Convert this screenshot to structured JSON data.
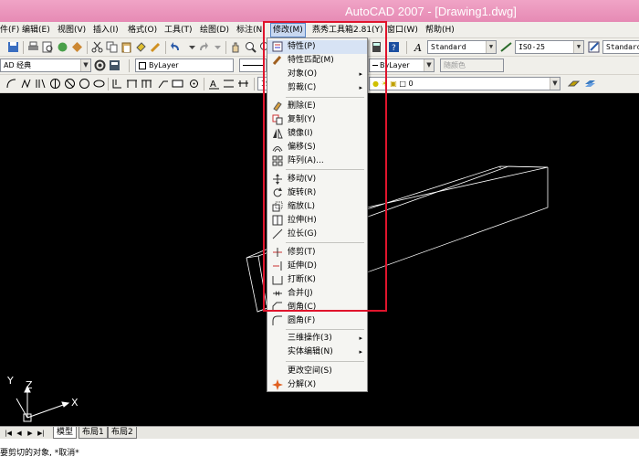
{
  "window": {
    "title": "AutoCAD 2007 - [Drawing1.dwg]"
  },
  "menubar": [
    {
      "label": "件(F)"
    },
    {
      "label": "编辑(E)"
    },
    {
      "label": "视图(V)"
    },
    {
      "label": "插入(I)"
    },
    {
      "label": "格式(O)"
    },
    {
      "label": "工具(T)"
    },
    {
      "label": "绘图(D)"
    },
    {
      "label": "标注(N)"
    },
    {
      "label": "修改(M)"
    },
    {
      "label": "燕秀工具箱2.81(Y)"
    },
    {
      "label": "窗口(W)"
    },
    {
      "label": "帮助(H)"
    }
  ],
  "toolbar1": {
    "text_style": "Standard",
    "dim_style": "ISO-25",
    "table_style": "Standard"
  },
  "toolbar2": {
    "workspace": "AD 经典",
    "color": "ByLayer",
    "linetype": "ByLayer",
    "plotstyle": "随颜色"
  },
  "toolbar3": {
    "layer_partial": "IS",
    "layer": "0"
  },
  "modify_menu": {
    "items": [
      {
        "label": "特性(P)",
        "icon": "properties-icon"
      },
      {
        "label": "特性匹配(M)",
        "icon": "match-properties-icon"
      },
      {
        "label": "对象(O)",
        "submenu": "▸"
      },
      {
        "label": "剪裁(C)",
        "submenu": "▸"
      },
      {
        "label": "删除(E)",
        "icon": "erase-icon"
      },
      {
        "label": "复制(Y)",
        "icon": "copy-icon"
      },
      {
        "label": "镜像(I)",
        "icon": "mirror-icon"
      },
      {
        "label": "偏移(S)",
        "icon": "offset-icon"
      },
      {
        "label": "阵列(A)...",
        "icon": "array-icon"
      },
      {
        "label": "移动(V)",
        "icon": "move-icon"
      },
      {
        "label": "旋转(R)",
        "icon": "rotate-icon"
      },
      {
        "label": "缩放(L)",
        "icon": "scale-icon"
      },
      {
        "label": "拉伸(H)",
        "icon": "stretch-icon"
      },
      {
        "label": "拉长(G)",
        "icon": "lengthen-icon"
      },
      {
        "label": "修剪(T)",
        "icon": "trim-icon"
      },
      {
        "label": "延伸(D)",
        "icon": "extend-icon"
      },
      {
        "label": "打断(K)",
        "icon": "break-icon"
      },
      {
        "label": "合并(J)",
        "icon": "join-icon"
      },
      {
        "label": "倒角(C)",
        "icon": "chamfer-icon"
      },
      {
        "label": "圆角(F)",
        "icon": "fillet-icon"
      },
      {
        "label": "三维操作(3)",
        "submenu": "▸"
      },
      {
        "label": "实体编辑(N)",
        "submenu": "▸"
      },
      {
        "label": "更改空间(S)"
      },
      {
        "label": "分解(X)",
        "icon": "explode-icon"
      }
    ]
  },
  "ucs": {
    "x": "X",
    "y": "Y",
    "z": "Z"
  },
  "layout_tabs": {
    "model": "模型",
    "layout1": "布局1",
    "layout2": "布局2"
  },
  "command_line": {
    "text": "要剪切的对象, *取消*"
  },
  "colors": {
    "titlebar": "#e68ab4",
    "canvas": "#000000",
    "highlight": "#e0142c"
  }
}
